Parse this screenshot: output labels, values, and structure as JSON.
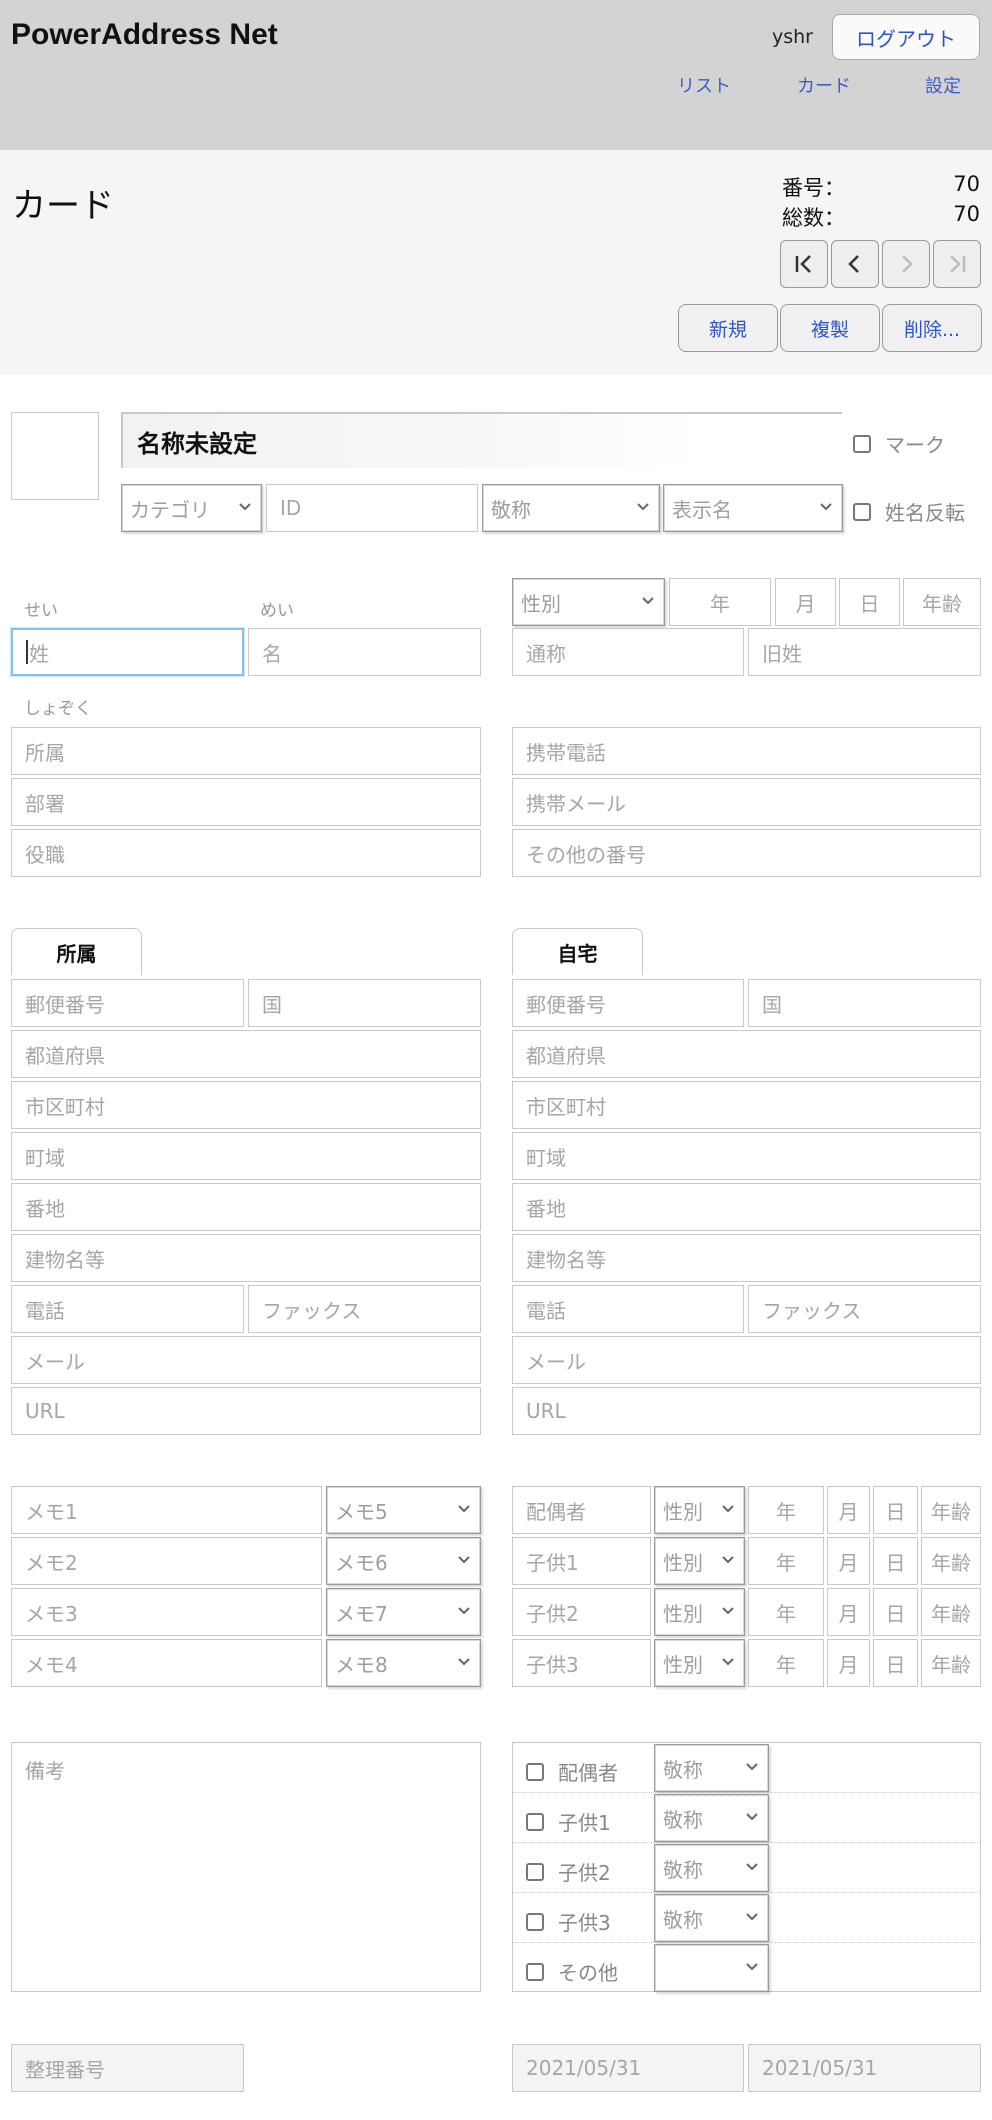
{
  "header": {
    "app_title": "PowerAddress Net",
    "user": "yshr",
    "logout": "ログアウト",
    "nav": [
      "リスト",
      "カード",
      "設定"
    ]
  },
  "card": {
    "title": "カード",
    "number_label": "番号：",
    "number_value": "70",
    "total_label": "総数：",
    "total_value": "70",
    "buttons": {
      "new": "新規",
      "duplicate": "複製",
      "delete": "削除..."
    }
  },
  "profile": {
    "display_name": "名称未設定",
    "category": "カテゴリ",
    "id": "ID",
    "honorific": "敬称",
    "display_format": "表示名",
    "mark_label": "マーク",
    "reverse_label": "姓名反転"
  },
  "name": {
    "sei_label": "せい",
    "mei_label": "めい",
    "last": "姓",
    "first": "名",
    "gender": "性別",
    "year": "年",
    "month": "月",
    "day": "日",
    "age": "年齢",
    "nickname": "通称",
    "maiden": "旧姓",
    "org_kana_label": "しょぞく",
    "org": "所属",
    "dept": "部署",
    "position": "役職",
    "mobile": "携帯電話",
    "mobile_mail": "携帯メール",
    "other_number": "その他の番号"
  },
  "address_tabs": {
    "work": "所属",
    "home": "自宅"
  },
  "address": {
    "postal": "郵便番号",
    "country": "国",
    "prefecture": "都道府県",
    "city": "市区町村",
    "town": "町域",
    "street": "番地",
    "building": "建物名等",
    "phone": "電話",
    "fax": "ファックス",
    "mail": "メール",
    "url": "URL"
  },
  "memos": {
    "text": [
      "メモ1",
      "メモ2",
      "メモ3",
      "メモ4"
    ],
    "select": [
      "メモ5",
      "メモ6",
      "メモ7",
      "メモ8"
    ]
  },
  "family": {
    "rows": [
      {
        "label": "配偶者"
      },
      {
        "label": "子供1"
      },
      {
        "label": "子供2"
      },
      {
        "label": "子供3"
      }
    ],
    "gender": "性別",
    "year": "年",
    "month": "月",
    "day": "日",
    "age": "年齢"
  },
  "notes": "備考",
  "recipients": {
    "rows": [
      {
        "label": "配偶者",
        "honorific": "敬称"
      },
      {
        "label": "子供1",
        "honorific": "敬称"
      },
      {
        "label": "子供2",
        "honorific": "敬称"
      },
      {
        "label": "子供3",
        "honorific": "敬称"
      },
      {
        "label": "その他",
        "honorific": ""
      }
    ]
  },
  "footer": {
    "serial": "整理番号",
    "created": "2021/05/31",
    "modified": "2021/05/31"
  }
}
